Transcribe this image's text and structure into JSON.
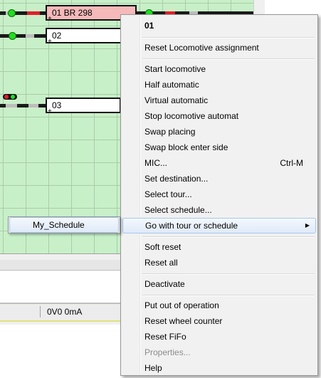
{
  "track_plan": {
    "blocks": [
      {
        "id": "block-01",
        "label": "01 BR 298",
        "occupied": true
      },
      {
        "id": "block-02",
        "label": "02",
        "occupied": false
      },
      {
        "id": "block-03",
        "label": "03",
        "occupied": false
      }
    ]
  },
  "status": {
    "power": "0V0 0mA"
  },
  "context_menu": {
    "header": "01",
    "items": [
      "Reset Locomotive assignment",
      "Start locomotive",
      "Half automatic",
      "Virtual automatic",
      "Stop locomotive automat",
      "Swap placing",
      "Swap block enter side",
      "MIC...",
      "Set destination...",
      "Select tour...",
      "Select schedule...",
      "Go with tour or schedule",
      "Soft reset",
      "Reset all",
      "Deactivate",
      "Put out of operation",
      "Reset wheel counter",
      "Reset FiFo",
      "Properties...",
      "Help"
    ],
    "mic_shortcut": "Ctrl-M"
  },
  "submenu": {
    "items": [
      "My_Schedule"
    ]
  },
  "colors": {
    "plan_background": "#c8f0c8",
    "occupied_block": "#f5b9b9",
    "signal_green": "#22dd22",
    "signal_red": "#e0202a",
    "highlight_border": "#a8c8ec"
  }
}
